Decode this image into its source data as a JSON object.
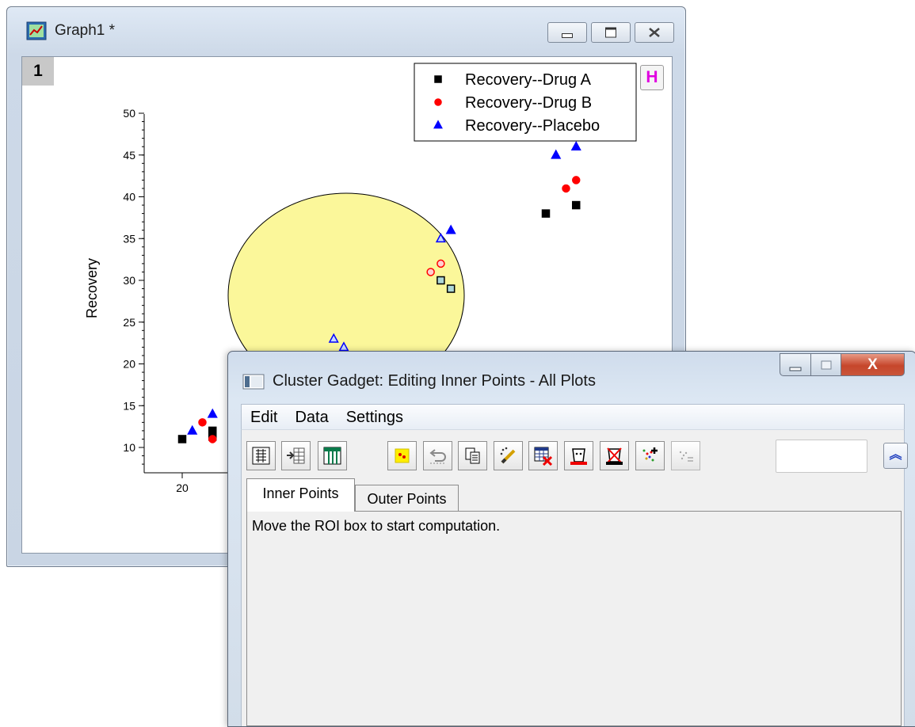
{
  "graph_window": {
    "title": "Graph1 *",
    "layer_label": "1",
    "h_button": "H"
  },
  "colors": {
    "roi_fill": "#fbf79a",
    "drug_a": "#000000",
    "drug_b": "#ff0000",
    "placebo": "#0000ff",
    "inner_point_fill": "#aed8d8"
  },
  "chart_data": {
    "type": "scatter",
    "xlabel": "",
    "ylabel": "Recovery",
    "ylim": [
      8,
      50
    ],
    "y_ticks": [
      10,
      15,
      20,
      25,
      30,
      35,
      40,
      45,
      50
    ],
    "x_ticks": [
      20
    ],
    "legend_position": "top-right",
    "series": [
      {
        "name": "Recovery--Drug A",
        "marker": "square",
        "points": [
          [
            20,
            11
          ],
          [
            21.5,
            12
          ],
          [
            21.5,
            11.3
          ],
          [
            32.8,
            30
          ],
          [
            33.3,
            29
          ],
          [
            38,
            38
          ],
          [
            39.5,
            39
          ]
        ]
      },
      {
        "name": "Recovery--Drug B",
        "marker": "circle",
        "points": [
          [
            21,
            13
          ],
          [
            21.5,
            11
          ],
          [
            32.3,
            31
          ],
          [
            32.8,
            32
          ],
          [
            28,
            21
          ],
          [
            39,
            41
          ],
          [
            39.5,
            42
          ]
        ]
      },
      {
        "name": "Recovery--Placebo",
        "marker": "triangle",
        "points": [
          [
            20.5,
            12
          ],
          [
            21.5,
            14
          ],
          [
            32.8,
            35
          ],
          [
            33.3,
            36
          ],
          [
            27.5,
            23
          ],
          [
            28,
            22
          ],
          [
            38.5,
            45
          ],
          [
            39.5,
            46
          ]
        ]
      }
    ]
  },
  "gadget": {
    "title": "Cluster Gadget: Editing Inner Points - All Plots",
    "close_glyph": "X",
    "menu": [
      "Edit",
      "Data",
      "Settings"
    ],
    "collapse_glyph": "︽",
    "search_value": "",
    "tabs": [
      "Inner Points",
      "Outer Points"
    ],
    "message": "Move the ROI box to start computation."
  }
}
